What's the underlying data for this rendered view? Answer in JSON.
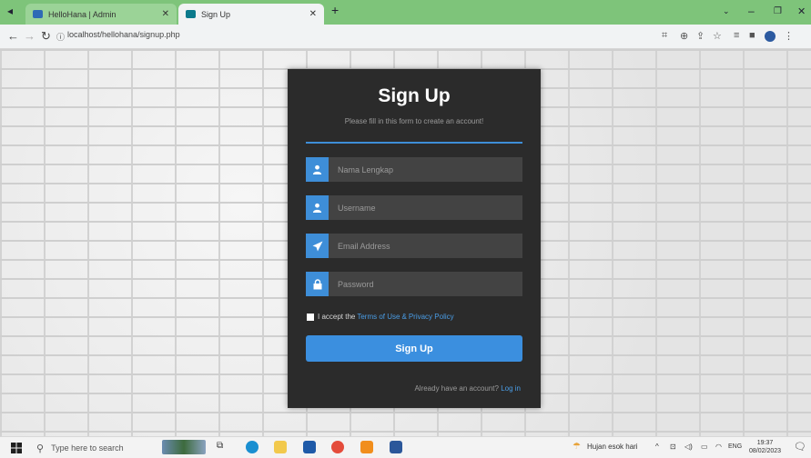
{
  "browser": {
    "tabs": [
      {
        "title": "HelloHana | Admin",
        "favicon_color": "#2f6bb5"
      },
      {
        "title": "Sign Up",
        "favicon_color": "#0b7a8c"
      }
    ],
    "new_tab": "+",
    "url": "localhost/hellohana/signup.php"
  },
  "form": {
    "title": "Sign Up",
    "subtitle": "Please fill in this form to create an account!",
    "fields": [
      {
        "placeholder": "Nama Lengkap",
        "icon": "user-icon"
      },
      {
        "placeholder": "Username",
        "icon": "user-icon"
      },
      {
        "placeholder": "Email Address",
        "icon": "paper-plane-icon"
      },
      {
        "placeholder": "Password",
        "icon": "lock-icon"
      }
    ],
    "terms_prefix": "I accept the",
    "terms_link1": "Terms of Use",
    "terms_amp": "&",
    "terms_link2": "Privacy Policy",
    "submit_label": "Sign Up",
    "login_prompt": "Already have an account?",
    "login_link": "Log in"
  },
  "taskbar": {
    "search_placeholder": "Type here to search",
    "weather": "Hujan esok hari",
    "language": "ENG",
    "time": "19:37",
    "date": "08/02/2023"
  },
  "colors": {
    "accent": "#3e8ed8",
    "panel": "#2b2b2b",
    "tabbar": "#7ec47a"
  }
}
